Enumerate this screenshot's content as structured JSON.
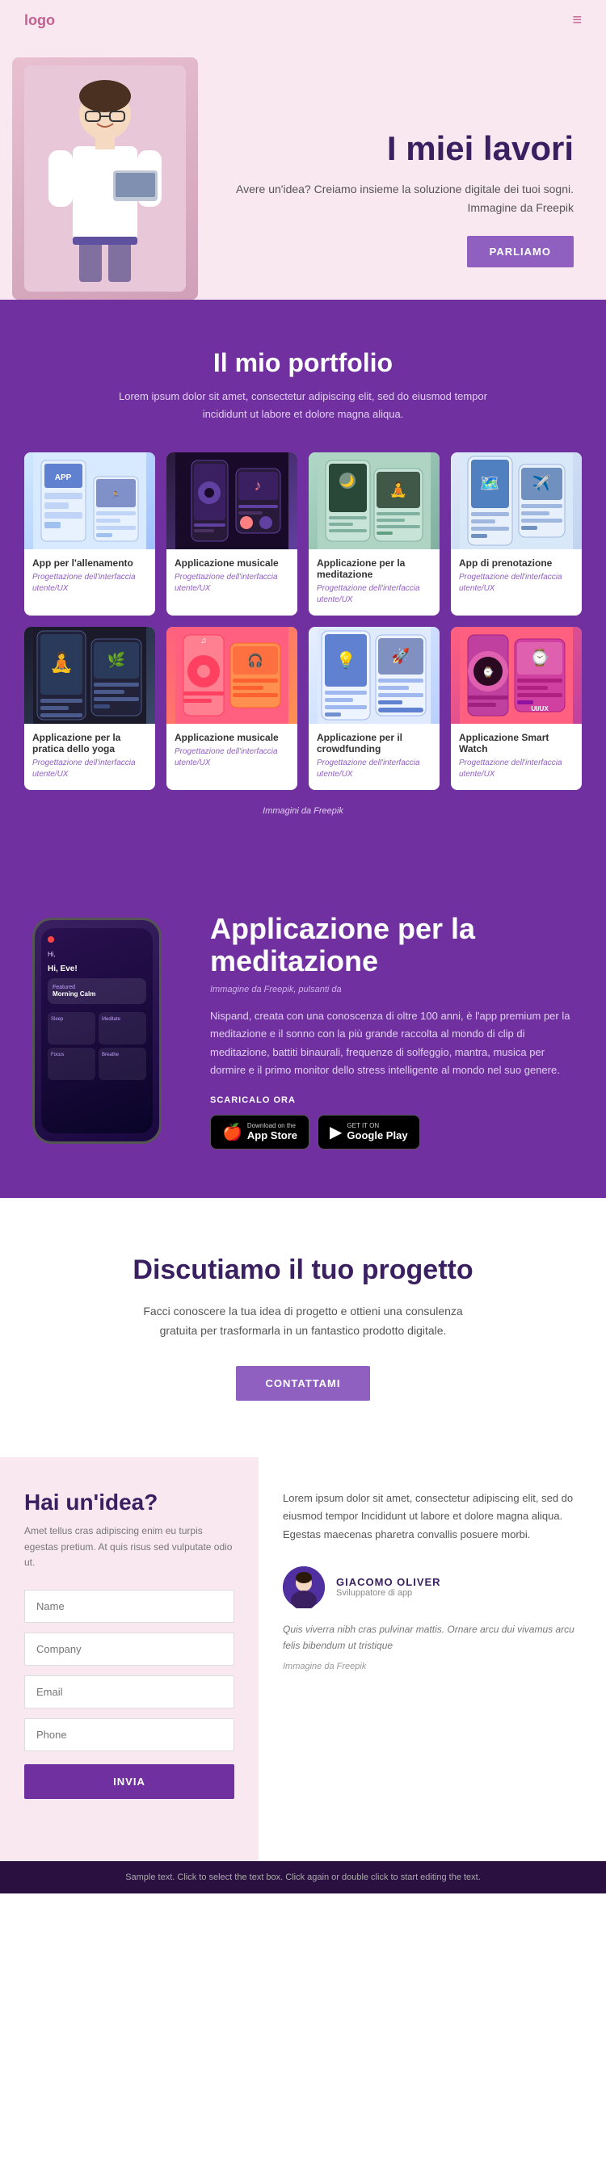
{
  "header": {
    "logo": "logo",
    "hamburger_icon": "≡"
  },
  "hero": {
    "title": "I miei lavori",
    "subtitle": "Avere un'idea? Creiamo insieme la soluzione digitale dei tuoi sogni. Immagine da Freepik",
    "cta_button": "PARLIAMO",
    "person_icon": "👨‍💼"
  },
  "portfolio": {
    "title": "Il mio portfolio",
    "subtitle": "Lorem ipsum dolor sit amet, consectetur adipiscing elit, sed do eiusmod tempor incididunt ut labore et dolore magna aliqua.",
    "credit": "Immagini da Freepik",
    "items": [
      {
        "title": "App per l'allenamento",
        "category": "Progettazione dell'interfaccia utente/UX",
        "icon": "🏃",
        "type": "fitness"
      },
      {
        "title": "Applicazione musicale",
        "category": "Progettazione dell'interfaccia utente/UX",
        "icon": "🎵",
        "type": "music"
      },
      {
        "title": "Applicazione per la meditazione",
        "category": "Progettazione dell'interfaccia utente/UX",
        "icon": "🧘",
        "type": "medit"
      },
      {
        "title": "App di prenotazione",
        "category": "Progettazione dell'interfaccia utente/UX",
        "icon": "📅",
        "type": "booking"
      },
      {
        "title": "Applicazione per la pratica dello yoga",
        "category": "Progettazione dell'interfaccia utente/UX",
        "icon": "🧘",
        "type": "yoga"
      },
      {
        "title": "Applicazione musicale",
        "category": "Progettazione dell'interfaccia utente/UX",
        "icon": "🎶",
        "type": "music2"
      },
      {
        "title": "Applicazione per il crowdfunding",
        "category": "Progettazione dell'interfaccia utente/UX",
        "icon": "💰",
        "type": "crowd"
      },
      {
        "title": "Applicazione Smart Watch",
        "category": "Progettazione dell'interfaccia utente/UX",
        "icon": "⌚",
        "type": "watch"
      }
    ]
  },
  "meditation_app": {
    "title": "Applicazione per la meditazione",
    "credit": "Immagine da Freepik, pulsanti da",
    "description": "Nispand, creata con una conoscenza di oltre 100 anni, è l'app premium per la meditazione e il sonno con la più grande raccolta al mondo di clip di meditazione, battiti binaurali, frequenze di solfeggio, mantra, musica per dormire e il primo monitor dello stress intelligente al mondo nel suo genere.",
    "download_label": "SCARICALO ORA",
    "phone_greeting": "Hi, Eve!",
    "app_store_label": "App Store",
    "google_play_label": "Google Play",
    "app_store_sub": "Download on the",
    "google_play_sub": "GET IT ON"
  },
  "cta": {
    "title": "Discutiamo il tuo progetto",
    "description": "Facci conoscere la tua idea di progetto e ottieni una consulenza gratuita per trasformarla in un fantastico prodotto digitale.",
    "button_label": "CONTATTAMI"
  },
  "contact": {
    "left": {
      "title": "Hai un'idea?",
      "subtitle": "Amet tellus cras adipiscing enim eu turpis egestas pretium. At quis risus sed vulputate odio ut.",
      "name_placeholder": "Name",
      "company_placeholder": "Company",
      "email_placeholder": "Email",
      "phone_placeholder": "Phone",
      "submit_label": "INVIA"
    },
    "right": {
      "text": "Lorem ipsum dolor sit amet, consectetur adipiscing elit, sed do eiusmod tempor Incididunt ut labore et dolore magna aliqua. Egestas maecenas pharetra convallis posuere morbi.",
      "author_name": "GIACOMO OLIVER",
      "author_role": "Sviluppatore di app",
      "quote": "Quis viverra nibh cras pulvinar mattis. Ornare arcu dui vivamus arcu felis bibendum ut tristique",
      "image_credit": "Immagine da Freepik"
    }
  },
  "footer": {
    "text": "Sample text. Click to select the text box. Click again or double click to start editing the text."
  }
}
